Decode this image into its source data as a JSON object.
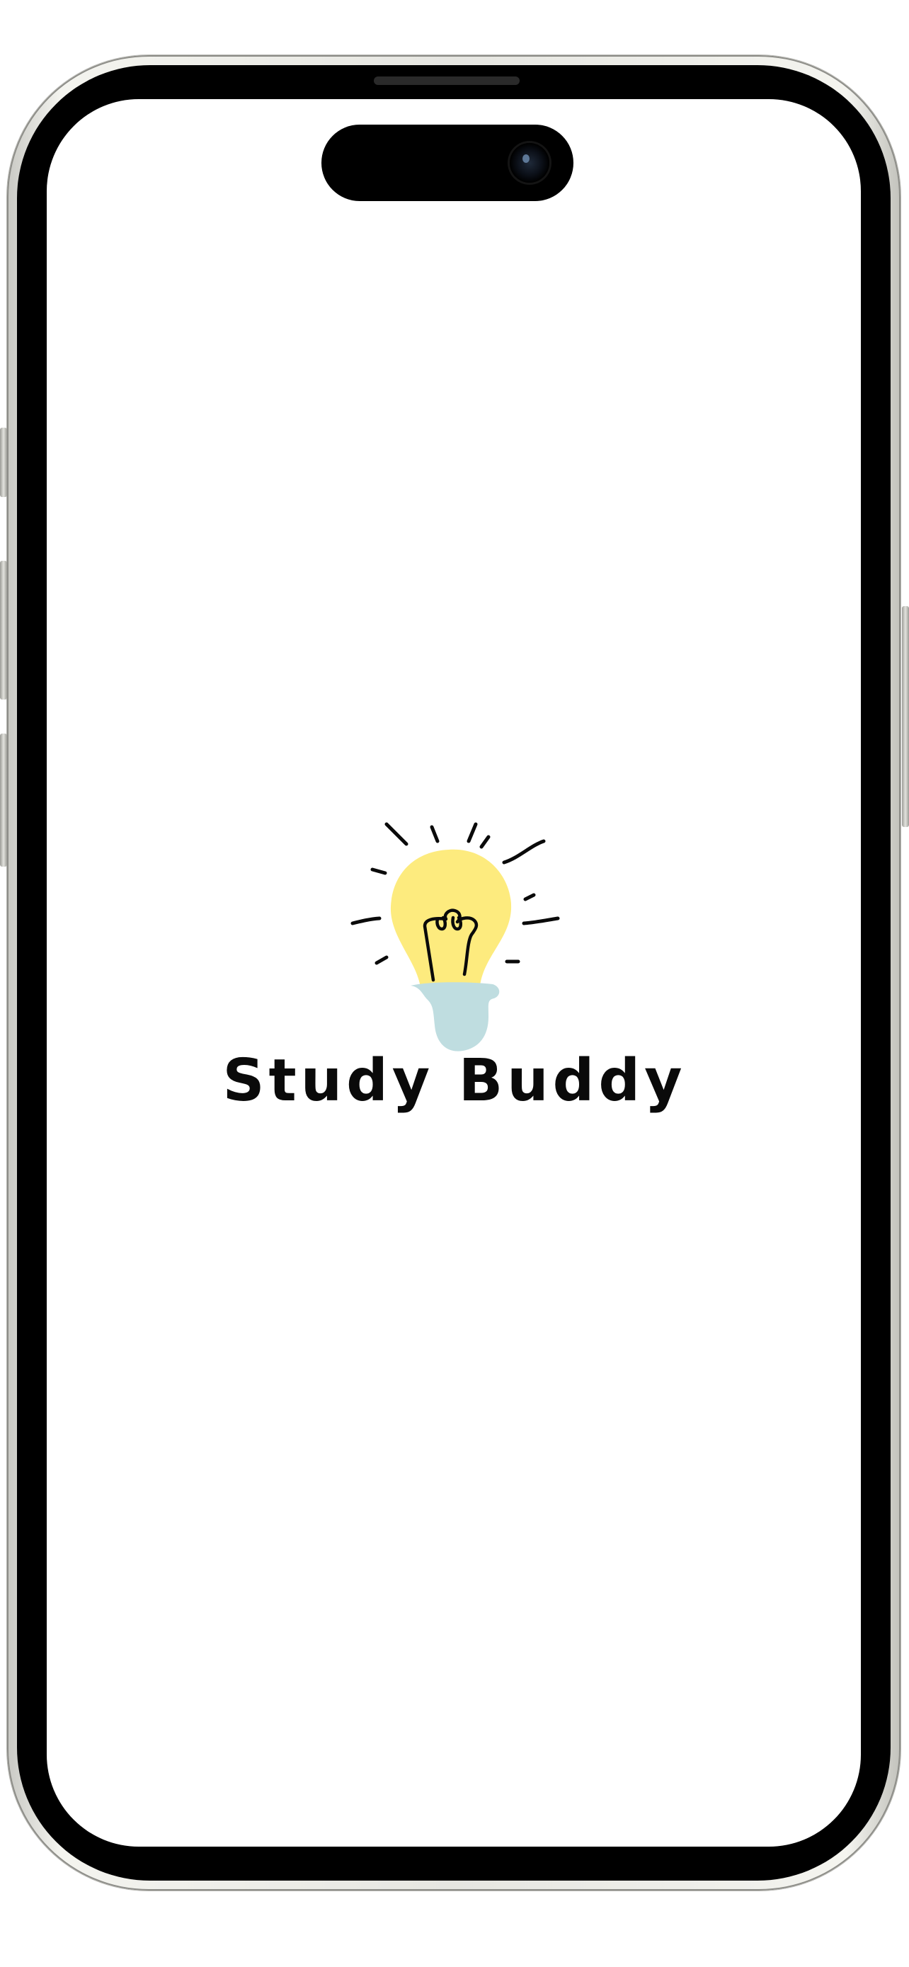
{
  "app": {
    "title": "Study Buddy",
    "logo_icon": "lightbulb-icon"
  },
  "colors": {
    "bulb": "#FDEB7E",
    "base": "#BFDDE0",
    "ink": "#0A0A0A",
    "background": "#FFFFFF"
  }
}
